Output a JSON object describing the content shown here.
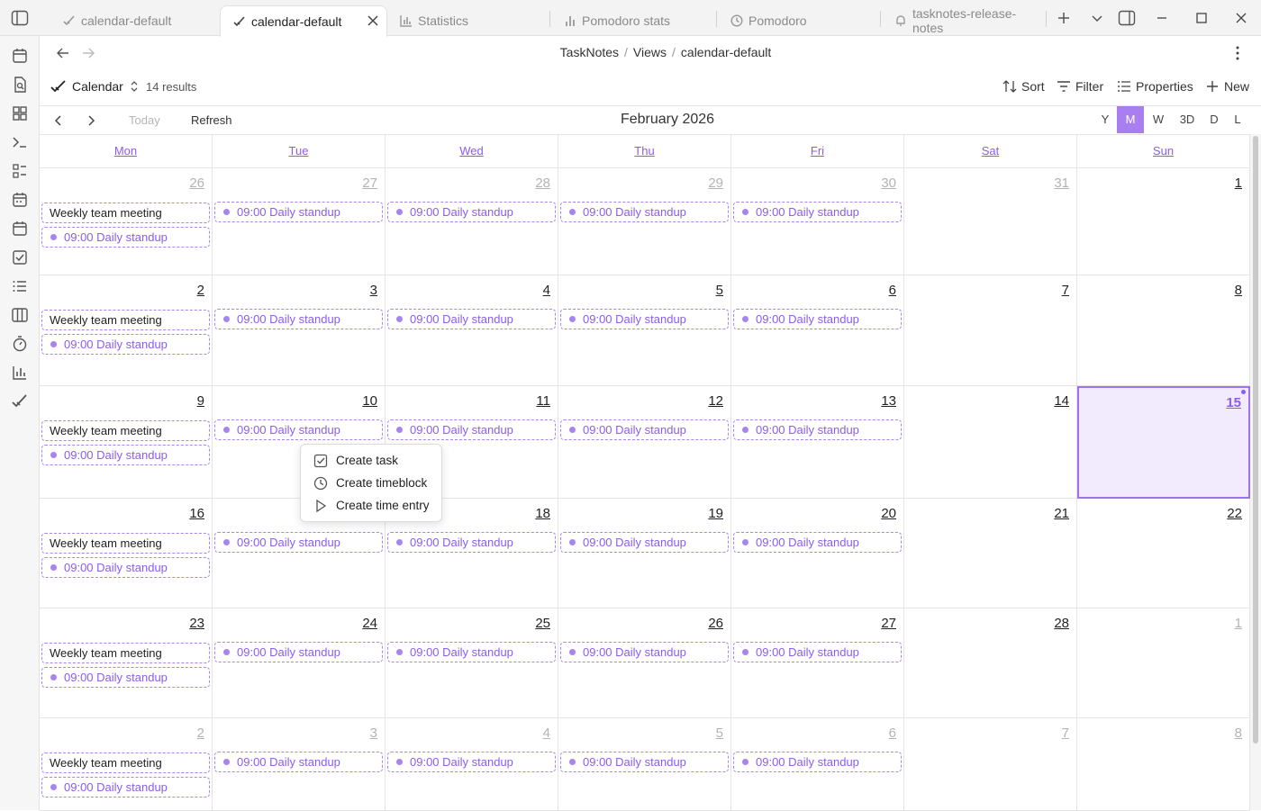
{
  "tabs": [
    {
      "label": "calendar-default",
      "icon": "tasknotes-check-icon",
      "active": false
    },
    {
      "label": "calendar-default",
      "icon": "tasknotes-check-icon",
      "active": true
    },
    {
      "label": "Statistics",
      "icon": "bar-chart-icon",
      "active": false
    },
    {
      "label": "Pomodoro stats",
      "icon": "bar-chart-icon",
      "active": false
    },
    {
      "label": "Pomodoro",
      "icon": "clock-icon",
      "active": false
    },
    {
      "label": "tasknotes-release-notes",
      "icon": "bell-icon",
      "active": false
    }
  ],
  "breadcrumb": {
    "part1": "TaskNotes",
    "part2": "Views",
    "part3": "calendar-default",
    "sep": "/"
  },
  "toolbar": {
    "view_label": "Calendar",
    "results": "14 results",
    "sort": "Sort",
    "filter": "Filter",
    "properties": "Properties",
    "new": "New"
  },
  "calendar": {
    "today_label": "Today",
    "refresh_label": "Refresh",
    "title": "February 2026",
    "view_buttons": [
      "Y",
      "M",
      "W",
      "3D",
      "D",
      "L"
    ],
    "active_view": "M",
    "weekdays": [
      "Mon",
      "Tue",
      "Wed",
      "Thu",
      "Fri",
      "Sat",
      "Sun"
    ],
    "weeks": [
      [
        {
          "d": "26",
          "o": true
        },
        {
          "d": "27",
          "o": true
        },
        {
          "d": "28",
          "o": true
        },
        {
          "d": "29",
          "o": true
        },
        {
          "d": "30",
          "o": true
        },
        {
          "d": "31",
          "o": true
        },
        {
          "d": "1",
          "o": false
        }
      ],
      [
        {
          "d": "2",
          "o": false
        },
        {
          "d": "3",
          "o": false
        },
        {
          "d": "4",
          "o": false
        },
        {
          "d": "5",
          "o": false
        },
        {
          "d": "6",
          "o": false
        },
        {
          "d": "7",
          "o": false
        },
        {
          "d": "8",
          "o": false
        }
      ],
      [
        {
          "d": "9",
          "o": false
        },
        {
          "d": "10",
          "o": false
        },
        {
          "d": "11",
          "o": false
        },
        {
          "d": "12",
          "o": false
        },
        {
          "d": "13",
          "o": false
        },
        {
          "d": "14",
          "o": false
        },
        {
          "d": "15",
          "o": false,
          "today": true
        }
      ],
      [
        {
          "d": "16",
          "o": false
        },
        {
          "d": "17",
          "o": false
        },
        {
          "d": "18",
          "o": false
        },
        {
          "d": "19",
          "o": false
        },
        {
          "d": "20",
          "o": false
        },
        {
          "d": "21",
          "o": false
        },
        {
          "d": "22",
          "o": false
        }
      ],
      [
        {
          "d": "23",
          "o": false
        },
        {
          "d": "24",
          "o": false
        },
        {
          "d": "25",
          "o": false
        },
        {
          "d": "26",
          "o": false
        },
        {
          "d": "27",
          "o": false
        },
        {
          "d": "28",
          "o": false
        },
        {
          "d": "1",
          "o": true
        }
      ],
      [
        {
          "d": "2",
          "o": true
        },
        {
          "d": "3",
          "o": true
        },
        {
          "d": "4",
          "o": true
        },
        {
          "d": "5",
          "o": true
        },
        {
          "d": "6",
          "o": true
        },
        {
          "d": "7",
          "o": true
        },
        {
          "d": "8",
          "o": true
        }
      ]
    ],
    "events": {
      "meeting": "Weekly team meeting",
      "standup": "09:00 Daily standup"
    }
  },
  "context_menu": {
    "items": [
      {
        "label": "Create task",
        "icon": "checkbox-icon"
      },
      {
        "label": "Create timeblock",
        "icon": "clock-icon"
      },
      {
        "label": "Create time entry",
        "icon": "play-icon"
      }
    ]
  },
  "colors": {
    "accent": "#8a5cf5",
    "event_border": "#a983ee",
    "today_bg": "#f1ebfd"
  }
}
